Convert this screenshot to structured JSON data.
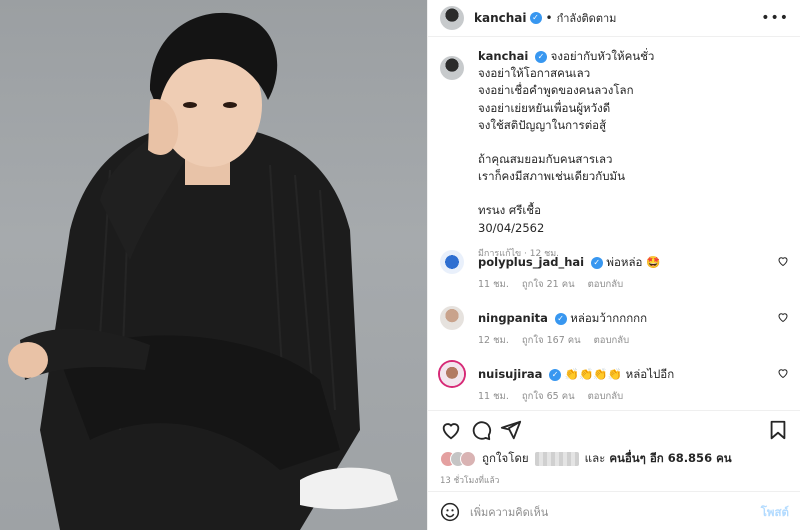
{
  "post": {
    "author": "kanchai",
    "follow_status": "กำลังติดตาม",
    "more_icon": "more-icon",
    "caption_lines": [
      "จงอย่ากับหัวให้คนชั่ว",
      "จงอย่าให้โอกาสคนเลว",
      "จงอย่าเชื่อคำพูดของคนลวงโลก",
      "จงอย่าเย่ยหยันเพื่อนผู้หวังดี",
      "จงใช้สติปัญญาในการต่อสู้",
      "ถ้าคุณสมยอมกับคนสารเลว",
      "เราก็คงมีสภาพเช่นเดียวกับมัน",
      "ทรนง ศรีเชื้อ",
      "30/04/2562"
    ],
    "caption_meta": "มีการแก้ไข · 12 ชม."
  },
  "comments": [
    {
      "user": "polyplus_jad_hai",
      "text": "พ่อหล่อ 🤩",
      "time": "11 ชม.",
      "likes": "ถูกใจ 21 คน",
      "reply": "ตอบกลับ"
    },
    {
      "user": "ningpanita",
      "text": "หล่อมว้ากกกกก",
      "time": "12 ชม.",
      "likes": "ถูกใจ 167 คน",
      "reply": "ตอบกลับ"
    },
    {
      "user": "nuisujiraa",
      "text": "👏👏👏👏 หล่อไปอีก",
      "time": "11 ชม.",
      "likes": "ถูกใจ 65 คน",
      "reply": "ตอบกลับ"
    }
  ],
  "likes": {
    "prefix": "ถูกใจโดย",
    "connector": "และ",
    "others": "คนอื่นๆ อีก 68.856 คน"
  },
  "time_ago": "13 ชั่วโมงที่แล้ว",
  "comment_box": {
    "placeholder": "เพิ่มความคิดเห็น",
    "post_label": "โพสต์"
  },
  "colors": {
    "verified": "#3897f0",
    "post_button": "#b3dbff",
    "meta_text": "#8e8e8e"
  }
}
